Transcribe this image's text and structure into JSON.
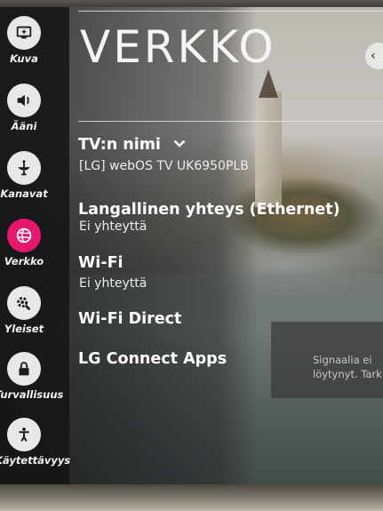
{
  "sidebar": {
    "items": [
      {
        "label": "Kuva",
        "icon": "picture-icon"
      },
      {
        "label": "Ääni",
        "icon": "speaker-icon"
      },
      {
        "label": "Kanavat",
        "icon": "antenna-icon"
      },
      {
        "label": "Verkko",
        "icon": "globe-icon",
        "active": true
      },
      {
        "label": "Yleiset",
        "icon": "gear-wrench-icon"
      },
      {
        "label": "Turvallisuus",
        "icon": "lock-icon"
      },
      {
        "label": "Käytettävyys",
        "icon": "accessibility-icon"
      }
    ]
  },
  "header": {
    "title": "VERKKO"
  },
  "settings": {
    "tv_name": {
      "label": "TV:n nimi",
      "value": "[LG] webOS TV UK6950PLB"
    },
    "ethernet": {
      "label": "Langallinen yhteys (Ethernet)",
      "value": "Ei yhteyttä"
    },
    "wifi": {
      "label": "Wi-Fi",
      "value": "Ei yhteyttä"
    },
    "wifi_direct": {
      "label": "Wi-Fi Direct"
    },
    "lg_connect": {
      "label": "LG Connect Apps"
    }
  },
  "status_panel": {
    "line1": "Signaalia ei",
    "line2": "löytynyt. Tarki"
  },
  "colors": {
    "accent": "#e6186d",
    "text": "#ffffff"
  }
}
